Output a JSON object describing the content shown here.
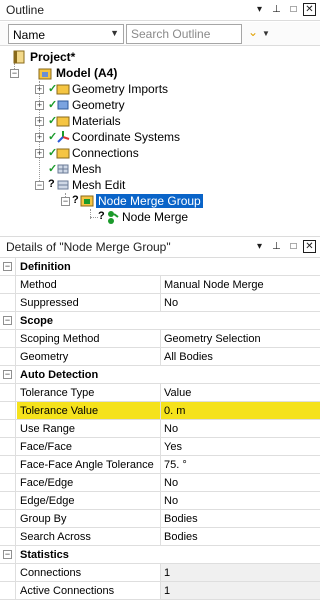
{
  "outline": {
    "title": "Outline",
    "buttons": {
      "dropdown": "▾",
      "pin": "⊥",
      "maximize": "□",
      "close": "✕"
    },
    "toolbar": {
      "sort_value": "Name",
      "search_placeholder": "Search Outline"
    },
    "tree": {
      "project": "Project*",
      "model": "Model (A4)",
      "items": [
        {
          "label": "Geometry Imports",
          "status": "✓"
        },
        {
          "label": "Geometry",
          "status": "✓"
        },
        {
          "label": "Materials",
          "status": "✓"
        },
        {
          "label": "Coordinate Systems",
          "status": "✓"
        },
        {
          "label": "Connections",
          "status": "✓"
        },
        {
          "label": "Mesh",
          "status": "✓"
        },
        {
          "label": "Mesh Edit",
          "status": "?"
        }
      ],
      "group": {
        "label": "Node Merge Group",
        "status": "?"
      },
      "child": {
        "label": "Node Merge",
        "status": "?"
      }
    }
  },
  "details": {
    "title": "Details of \"Node Merge Group\"",
    "sections": [
      {
        "label": "Definition",
        "rows": [
          {
            "name": "Method",
            "value": "Manual Node Merge"
          },
          {
            "name": "Suppressed",
            "value": "No"
          }
        ]
      },
      {
        "label": "Scope",
        "rows": [
          {
            "name": "Scoping Method",
            "value": "Geometry Selection"
          },
          {
            "name": "Geometry",
            "value": "All Bodies"
          }
        ]
      },
      {
        "label": "Auto Detection",
        "rows": [
          {
            "name": "Tolerance Type",
            "value": "Value"
          },
          {
            "name": "Tolerance Value",
            "value": "0. m"
          },
          {
            "name": "Use Range",
            "value": "No"
          },
          {
            "name": "Face/Face",
            "value": "Yes"
          },
          {
            "name": "Face-Face Angle Tolerance",
            "value": "75. °"
          },
          {
            "name": "Face/Edge",
            "value": "No"
          },
          {
            "name": "Edge/Edge",
            "value": "No"
          },
          {
            "name": "Group By",
            "value": "Bodies"
          },
          {
            "name": "Search Across",
            "value": "Bodies"
          }
        ]
      },
      {
        "label": "Statistics",
        "rows": [
          {
            "name": "Connections",
            "value": "1"
          },
          {
            "name": "Active Connections",
            "value": "1"
          }
        ]
      }
    ]
  },
  "colors": {
    "highlight": "#f5e21c",
    "selection": "#0a64c8",
    "check": "#1a9a2a"
  }
}
